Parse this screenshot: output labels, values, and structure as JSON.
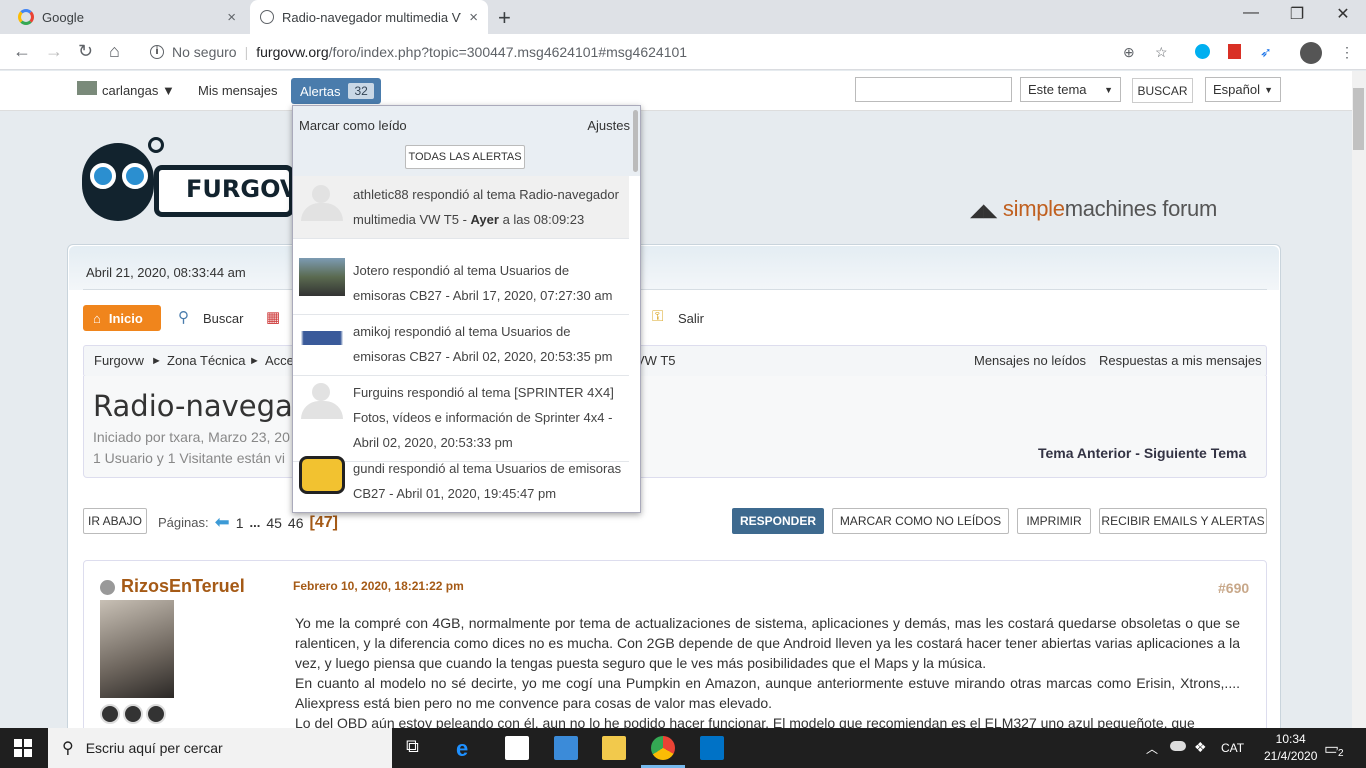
{
  "browser": {
    "tabs": [
      {
        "label": "Google"
      },
      {
        "label": "Radio-navegador multimedia VW"
      }
    ],
    "security": "No seguro",
    "url_host": "furgovw.org",
    "url_path": "/foro/index.php?topic=300447.msg4624101#msg4624101",
    "new_tab": "+",
    "close": "×"
  },
  "userbar": {
    "username": "carlangas ▼",
    "my_messages": "Mis mensajes",
    "alerts_label": "Alertas",
    "alerts_count": "32",
    "scope": "Este tema",
    "search_button": "BUSCAR",
    "language": "Español"
  },
  "site": {
    "logo_text": "FURGOVW",
    "smf_a": "simple",
    "smf_b": "machines",
    "smf_c": " forum"
  },
  "forum": {
    "date": "Abril 21, 2020, 08:33:44 am",
    "menu": {
      "home": "Inicio",
      "search": "Buscar",
      "logout": "Salir"
    },
    "breadcrumb": [
      "Furgovw",
      "►",
      "Zona Técnica",
      "►",
      "Acce",
      "VW T5"
    ],
    "unread": "Mensajes no leídos",
    "replies": "Respuestas a mis mensajes",
    "topic_title": "Radio-navegado",
    "started_by": "Iniciado por txara, Marzo 23, 20",
    "viewers": "1 Usuario y 1 Visitante están vi",
    "prev_topic": "Tema Anterior",
    "sep": " - ",
    "next_topic": "Siguiente Tema",
    "go_down": "IR ABAJO",
    "pages_label": "Páginas:",
    "pages": [
      "1",
      "...",
      "45",
      "46",
      "[47]"
    ],
    "buttons": {
      "reply": "RESPONDER",
      "mark_unread": "MARCAR COMO NO LEÍDOS",
      "print": "IMPRIMIR",
      "notify": "RECIBIR EMAILS Y ALERTAS"
    }
  },
  "post": {
    "author": "RizosEnTeruel",
    "date": "Febrero 10, 2020, 18:21:22 pm",
    "number": "#690",
    "body": "Yo me la compré con 4GB, normalmente por tema de actualizaciones de sistema, aplicaciones y demás, mas les costará quedarse obsoletas o que se ralenticen, y la diferencia como dices no es mucha. Con 2GB depende de que Android lleven ya les costará hacer tener abiertas varias aplicaciones a la vez, y luego piensa que cuando la tengas puesta seguro que le ves más posibilidades que el Maps y la música.\nEn cuanto al modelo no sé decirte, yo me cogí una Pumpkin en Amazon, aunque anteriormente estuve mirando otras marcas como Erisin, Xtrons,.... Aliexpress está bien pero no me convence para cosas de valor mas elevado.\nLo del OBD aún estoy peleando con él, aun no lo he podido hacer funcionar. El modelo que recomiendan es el ELM327 uno azul pequeñote, que"
  },
  "alerts_dropdown": {
    "mark_read": "Marcar como leído",
    "settings": "Ajustes",
    "all_alerts": "TODAS LAS ALERTAS",
    "items": [
      {
        "user": "athletic88",
        "pre": " respondió al tema Radio-navegador multimedia VW T5 - ",
        "when": "Ayer",
        "post": " a las 08:09:23"
      },
      {
        "user": "Jotero",
        "pre": " respondió al tema Usuarios de emisoras CB27 - ",
        "when": "",
        "post": "Abril 17, 2020, 07:27:30 am"
      },
      {
        "user": "amikoj",
        "pre": " respondió al tema Usuarios de emisoras CB27 - ",
        "when": "",
        "post": "Abril 02, 2020, 20:53:35 pm"
      },
      {
        "user": "Furguins",
        "pre": " respondió al tema [SPRINTER 4X4] Fotos, vídeos e información de Sprinter 4x4 - ",
        "when": "",
        "post": "Abril 02, 2020, 20:53:33 pm"
      },
      {
        "user": "gundi",
        "pre": " respondió al tema Usuarios de emisoras CB27 - ",
        "when": "",
        "post": "Abril 01, 2020, 19:45:47 pm"
      }
    ]
  },
  "taskbar": {
    "search_placeholder": "Escriu aquí per cercar",
    "lang": "CAT",
    "time": "10:34",
    "date": "21/4/2020",
    "notif_count": "2"
  },
  "colors": {
    "accent": "#4a7cac",
    "orange": "#f0851c",
    "author": "#a55a16"
  }
}
